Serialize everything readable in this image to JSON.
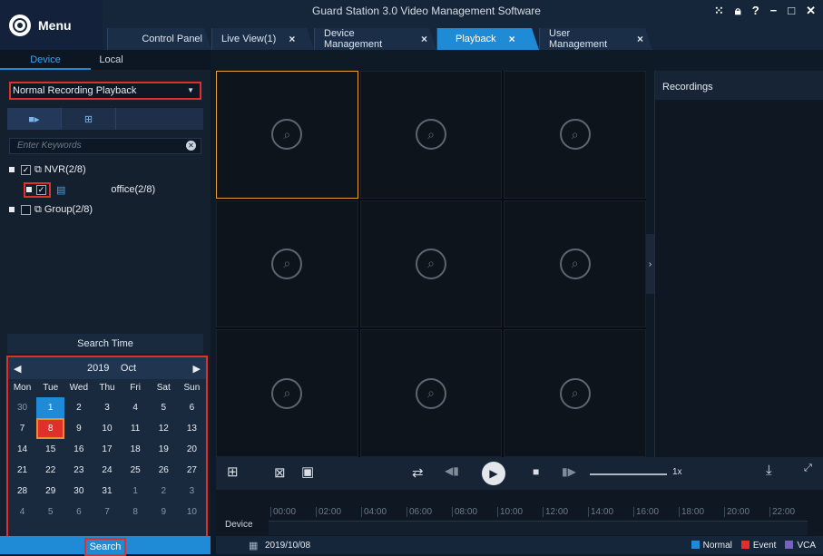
{
  "app": {
    "title": "Guard Station 3.0 Video Management Software",
    "menu_label": "Menu"
  },
  "tabs": [
    {
      "label": "Control Panel"
    },
    {
      "label": "Live View(1)",
      "close": "×"
    },
    {
      "label": "Device Management",
      "close": "×"
    },
    {
      "label": "Playback",
      "close": "×"
    },
    {
      "label": "User Management",
      "close": "×"
    }
  ],
  "subtabs": {
    "device": "Device",
    "local": "Local"
  },
  "left": {
    "dropdown": "Normal Recording Playback",
    "keywords_placeholder": "Enter Keywords",
    "tree": {
      "nvr": "NVR(2/8)",
      "office": "office(2/8)",
      "group": "Group(2/8)"
    },
    "search_time": "Search Time",
    "search_button": "Search"
  },
  "calendar": {
    "year": "2019",
    "month": "Oct",
    "weekdays": [
      "Mon",
      "Tue",
      "Wed",
      "Thu",
      "Fri",
      "Sat",
      "Sun"
    ],
    "days": [
      "30",
      "1",
      "2",
      "3",
      "4",
      "5",
      "6",
      "7",
      "8",
      "9",
      "10",
      "11",
      "12",
      "13",
      "14",
      "15",
      "16",
      "17",
      "18",
      "19",
      "20",
      "21",
      "22",
      "23",
      "24",
      "25",
      "26",
      "27",
      "28",
      "29",
      "30",
      "31",
      "1",
      "2",
      "3",
      "4",
      "5",
      "6",
      "7",
      "8",
      "9",
      "10"
    ]
  },
  "recordings": {
    "title": "Recordings"
  },
  "player": {
    "speed": "1x"
  },
  "timeline": {
    "label": "Device",
    "hours": [
      "00:00",
      "02:00",
      "04:00",
      "06:00",
      "08:00",
      "10:00",
      "12:00",
      "14:00",
      "16:00",
      "18:00",
      "20:00",
      "22:00"
    ]
  },
  "status": {
    "date": "2019/10/08",
    "legend": [
      {
        "label": "Normal",
        "color": "#1f8ad6"
      },
      {
        "label": "Event",
        "color": "#e0302c"
      },
      {
        "label": "VCA",
        "color": "#7a5fc4"
      }
    ]
  }
}
